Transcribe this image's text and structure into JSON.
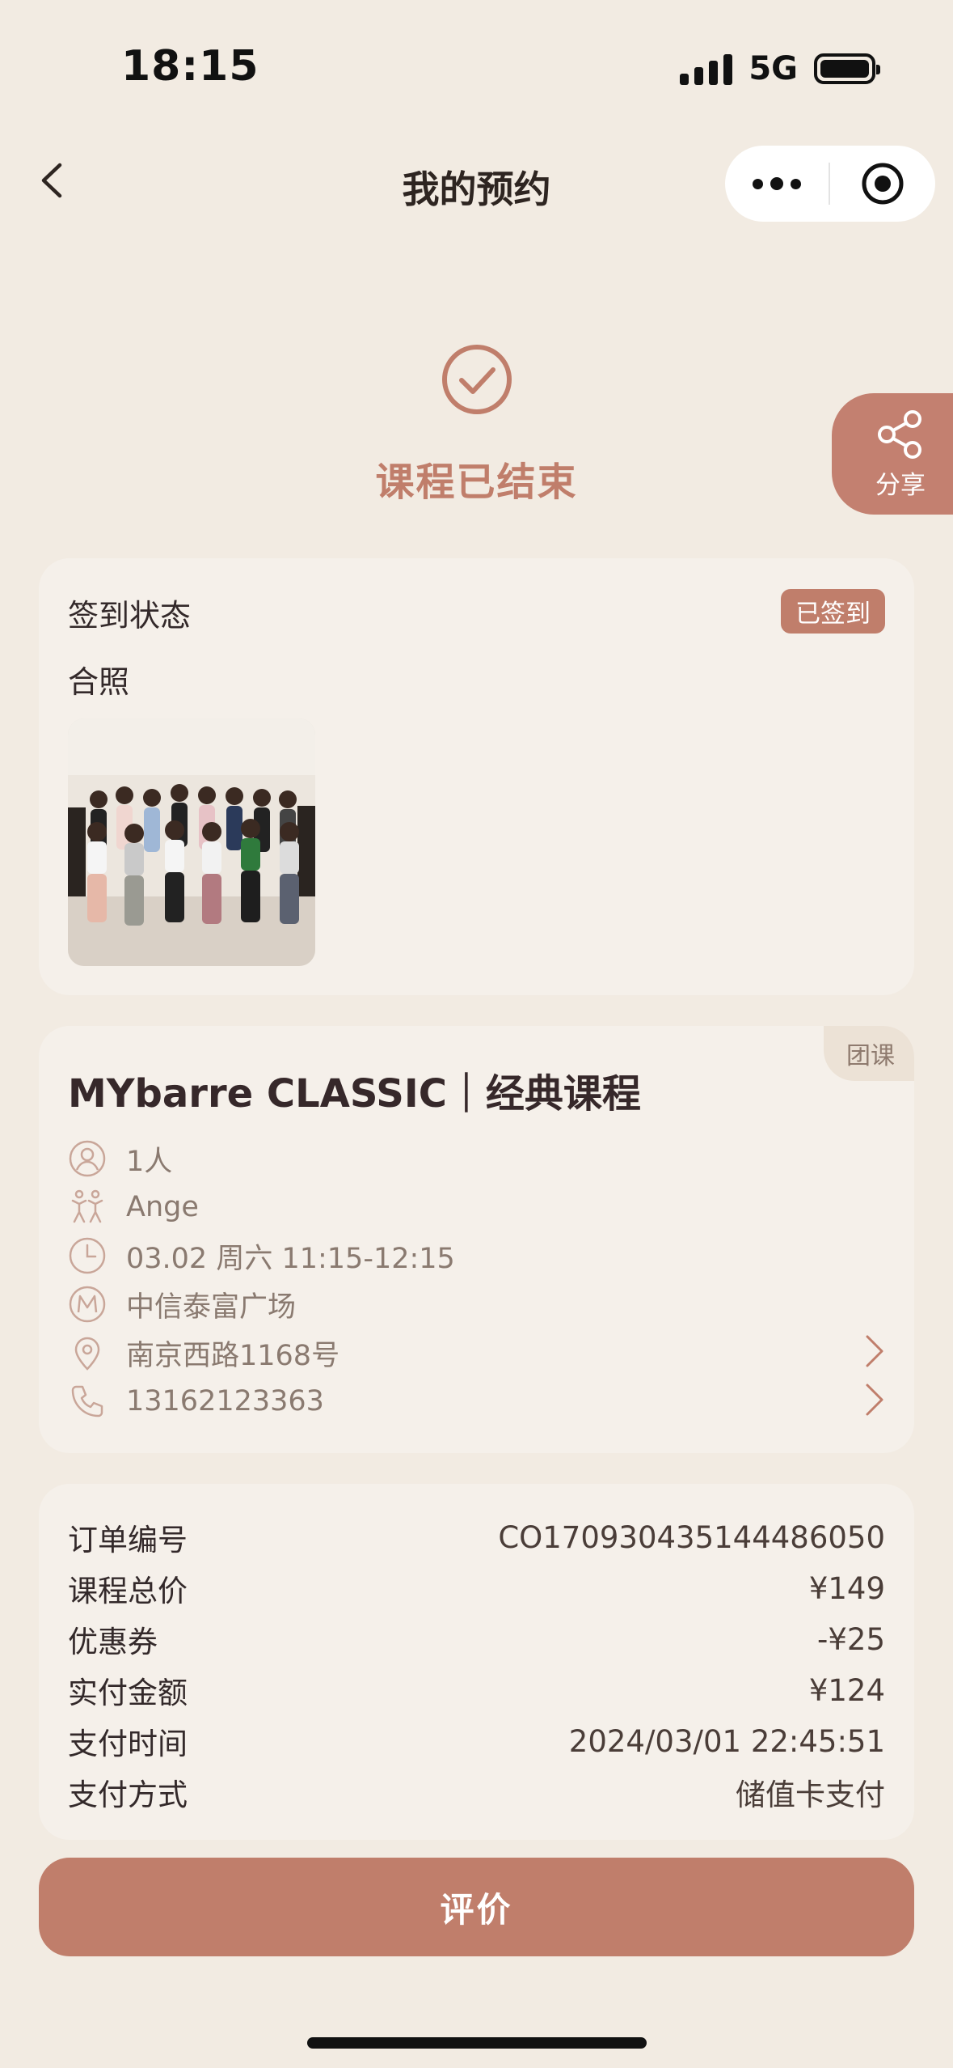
{
  "status_bar": {
    "time": "18:15",
    "network": "5G"
  },
  "nav": {
    "title": "我的预约"
  },
  "hero": {
    "status_text": "课程已结束",
    "share_label": "分享"
  },
  "checkin_card": {
    "status_label": "签到状态",
    "status_badge": "已签到",
    "photo_label": "合照"
  },
  "course_card": {
    "tag": "团课",
    "title": "MYbarre CLASSIC｜经典课程",
    "items": [
      {
        "icon": "person-icon",
        "text": "1人"
      },
      {
        "icon": "dancers-icon",
        "text": "Ange"
      },
      {
        "icon": "clock-icon",
        "text": "03.02 周六 11:15-12:15"
      },
      {
        "icon": "brand-m-icon",
        "text": "中信泰富广场"
      },
      {
        "icon": "location-pin-icon",
        "text": "南京西路1168号"
      },
      {
        "icon": "phone-icon",
        "text": "13162123363"
      }
    ]
  },
  "order_card": {
    "rows": [
      {
        "label": "订单编号",
        "value": "CO170930435144486050"
      },
      {
        "label": "课程总价",
        "value": "¥149"
      },
      {
        "label": "优惠券",
        "value": "-¥25"
      },
      {
        "label": "实付金额",
        "value": "¥124"
      },
      {
        "label": "支付时间",
        "value": "2024/03/01 22:45:51"
      },
      {
        "label": "支付方式",
        "value": "储值卡支付"
      }
    ]
  },
  "action": {
    "review_label": "评价"
  },
  "colors": {
    "accent": "#c07e6b",
    "background": "#f2ebe2",
    "card": "#f5f0ea"
  }
}
